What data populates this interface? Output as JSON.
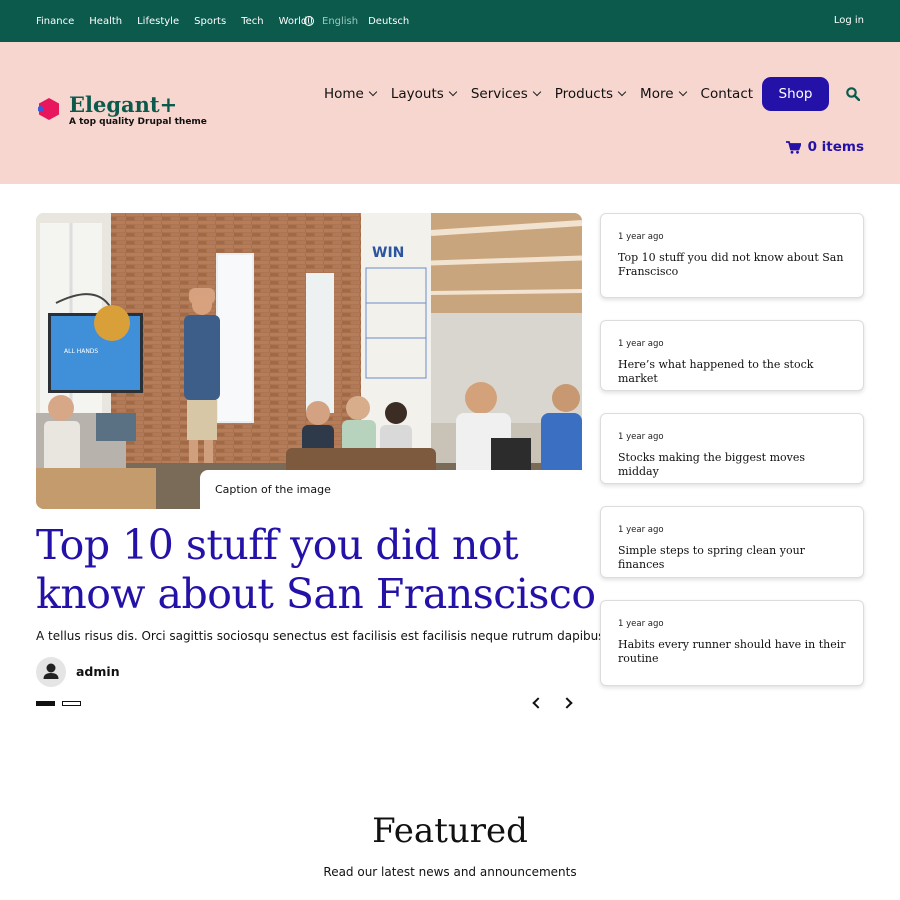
{
  "topbar": {
    "categories": [
      "Finance",
      "Health",
      "Lifestyle",
      "Sports",
      "Tech",
      "World"
    ],
    "lang_current": "English",
    "lang_other": "Deutsch",
    "login": "Log in",
    "globe_icon": "globe-icon",
    "bg_color": "#0b5a4c"
  },
  "header": {
    "logo_name": "Elegant+",
    "tagline": "A top quality Drupal theme",
    "nav": [
      "Home",
      "Layouts",
      "Services",
      "Products",
      "More",
      "Contact"
    ],
    "shop_label": "Shop",
    "cart_label": "0 items",
    "search_icon": "search-icon",
    "cart_icon": "cart-icon",
    "bg_color": "#f7d6cf",
    "accent_color": "#2411a8"
  },
  "hero": {
    "caption": "Caption of the image",
    "title": "Top 10 stuff you did not know about San Franscisco",
    "description": "A tellus risus dis. Orci sagittis sociosqu senectus est facilisis est facilisis neque rutrum dapibus!",
    "author": "admin",
    "slide_current": 1,
    "slide_total": 2
  },
  "sidebar": {
    "items": [
      {
        "time": "1 year ago",
        "title": "Top 10 stuff you did not know about San Franscisco"
      },
      {
        "time": "1 year ago",
        "title": "Here’s what happened to the stock market"
      },
      {
        "time": "1 year ago",
        "title": "Stocks making the biggest moves midday"
      },
      {
        "time": "1 year ago",
        "title": "Simple steps to spring clean your finances"
      },
      {
        "time": "1 year ago",
        "title": "Habits every runner should have in their routine"
      }
    ]
  },
  "featured": {
    "title": "Featured",
    "subtitle": "Read our latest news and announcements"
  }
}
